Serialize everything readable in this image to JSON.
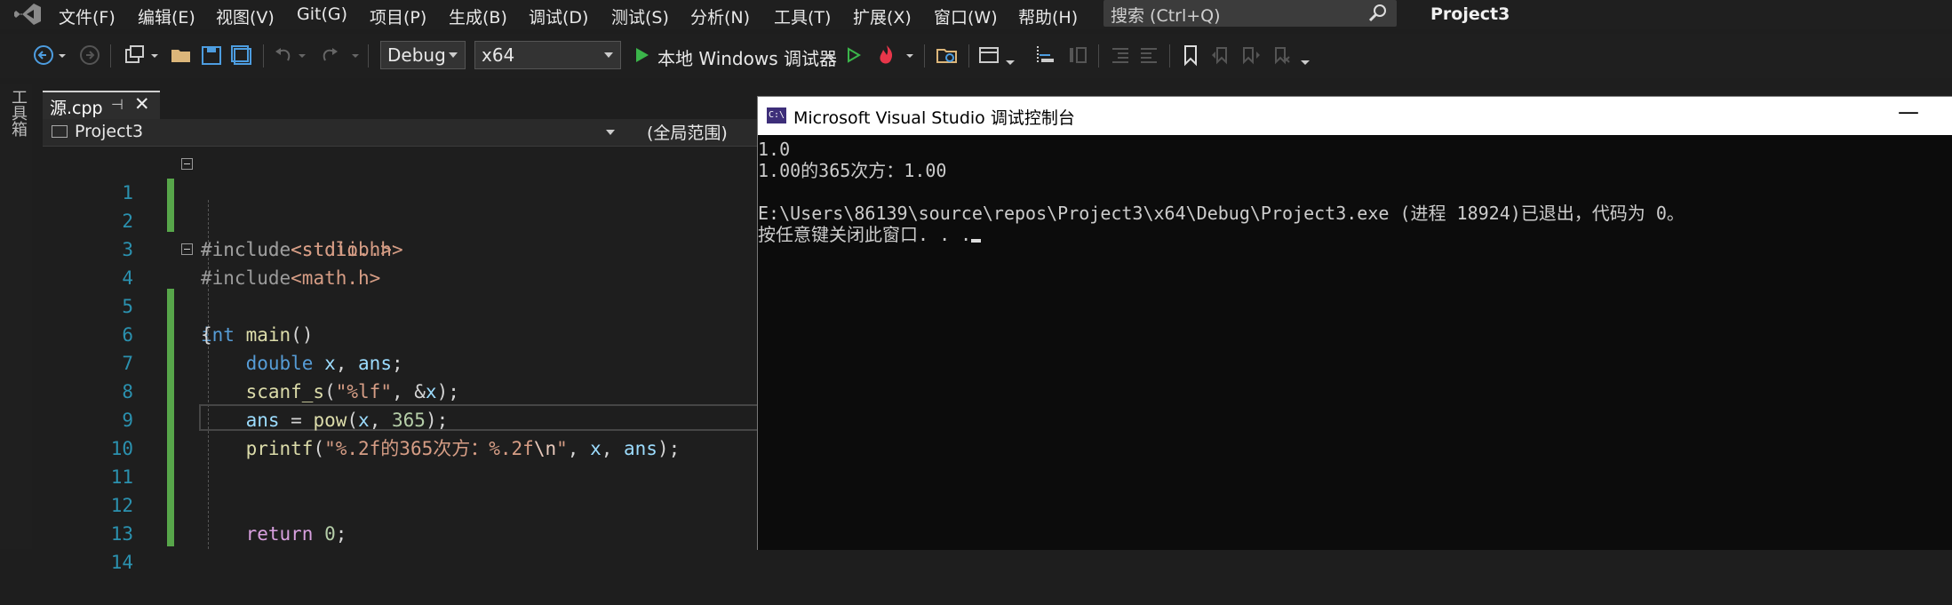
{
  "menu": {
    "items": [
      "文件(F)",
      "编辑(E)",
      "视图(V)",
      "Git(G)",
      "项目(P)",
      "生成(B)",
      "调试(D)",
      "测试(S)",
      "分析(N)",
      "工具(T)",
      "扩展(X)",
      "窗口(W)",
      "帮助(H)"
    ],
    "search_placeholder": "搜索 (Ctrl+Q)",
    "project_title": "Project3"
  },
  "toolbar": {
    "config": "Debug",
    "platform": "x64",
    "run_label": "本地 Windows 调试器"
  },
  "toolbox": {
    "label": "工具箱"
  },
  "editor": {
    "tab_name": "源.cpp",
    "nav_project": "Project3",
    "nav_scope": "(全局范围)",
    "line_numbers": [
      "1",
      "2",
      "3",
      "4",
      "5",
      "6",
      "7",
      "8",
      "9",
      "10",
      "11",
      "12",
      "13",
      "14"
    ],
    "lines": {
      "l1": {
        "pre": "#include",
        "inc": "<stdio.h>"
      },
      "l2": {
        "pre": "#include",
        "inc": "<stdlib.h>"
      },
      "l3": {
        "pre": "#include",
        "inc": "<math.h>"
      },
      "l4": {
        "kw": "int",
        "fn": "main",
        "rest": "()"
      },
      "l5": {
        "text": "{"
      },
      "l6": {
        "kw": "double",
        "a": " x",
        "b": ", ",
        "c": "ans",
        "d": ";"
      },
      "l7": {
        "fn": "scanf_s",
        "a": "(",
        "str": "\"%lf\"",
        "b": ", &",
        "id": "x",
        "c": ");"
      },
      "l8": {
        "id1": "ans",
        "a": " = ",
        "fn": "pow",
        "b": "(",
        "id2": "x",
        "c": ", ",
        "num": "365",
        "d": ");"
      },
      "l9": {
        "fn": "printf",
        "a": "(",
        "str1": "\"%.2f的365次方：%.2f",
        "esc": "\\n",
        "str2": "\"",
        "b": ", ",
        "id1": "x",
        "c": ", ",
        "id2": "ans",
        "d": ");"
      },
      "l12": {
        "kw": "return",
        "a": " ",
        "num": "0",
        "b": ";"
      }
    }
  },
  "console": {
    "title": "Microsoft Visual Studio 调试控制台",
    "icon_text": "C:\\",
    "minimize": "—",
    "lines": [
      "1.0",
      "1.00的365次方：1.00",
      "",
      "E:\\Users\\86139\\source\\repos\\Project3\\x64\\Debug\\Project3.exe (进程 18924)已退出，代码为 0。",
      "按任意键关闭此窗口. . ."
    ]
  }
}
